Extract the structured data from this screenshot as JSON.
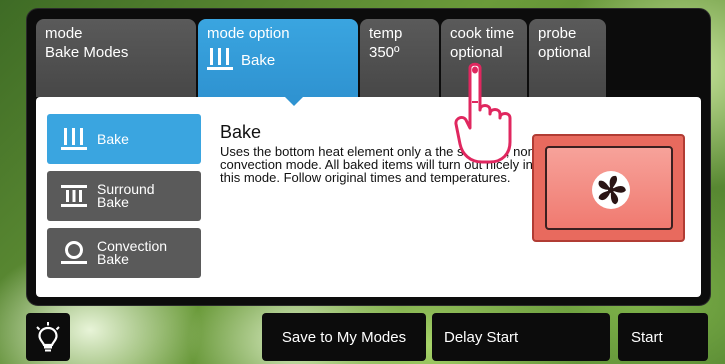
{
  "tabs": {
    "mode": {
      "label": "mode",
      "value": "Bake Modes"
    },
    "mode_option": {
      "label": "mode option",
      "value": "Bake"
    },
    "temp": {
      "label": "temp",
      "value": "350º"
    },
    "cook_time": {
      "label": "cook time",
      "value": "optional"
    },
    "probe": {
      "label": "probe",
      "value": "optional"
    }
  },
  "modes": [
    {
      "label_line1": "Bake",
      "label_line2": "",
      "selected": true,
      "icon": "bake-icon"
    },
    {
      "label_line1": "Surround",
      "label_line2": "Bake",
      "selected": false,
      "icon": "surround-bake-icon"
    },
    {
      "label_line1": "Convection",
      "label_line2": "Bake",
      "selected": false,
      "icon": "convection-bake-icon"
    }
  ],
  "description": {
    "title": "Bake",
    "body": "Uses the bottom heat element only a the stand-by, non convection mode. All baked items will turn out nicely in this mode. Follow original times and temperatures."
  },
  "fan_button": {
    "icon": "fan-icon"
  },
  "bottom_bar": {
    "light_icon": "light-bulb-icon",
    "save_label": "Save to My Modes",
    "delay_label": "Delay Start",
    "start_label": "Start"
  },
  "colors": {
    "accent": "#2f93d1",
    "tab_inactive": "#4f4f4f",
    "panel": "#0c0c0c",
    "fan_button": "#e86a5e"
  }
}
